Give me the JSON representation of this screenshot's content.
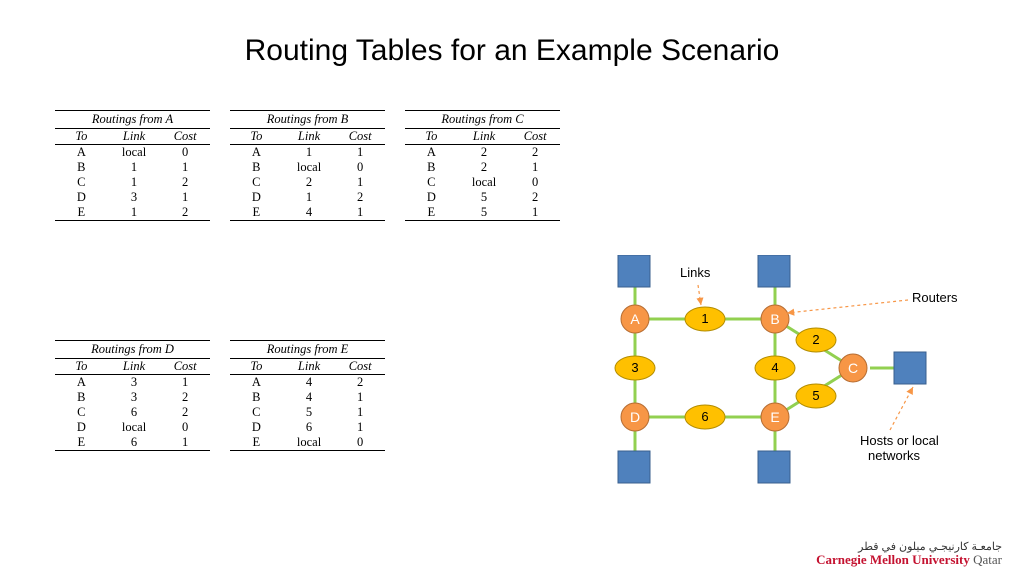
{
  "title": "Routing Tables for an Example Scenario",
  "headers": {
    "to": "To",
    "link": "Link",
    "cost": "Cost"
  },
  "tables": {
    "A": {
      "caption": "Routings from A",
      "rows": [
        {
          "to": "A",
          "link": "local",
          "cost": "0"
        },
        {
          "to": "B",
          "link": "1",
          "cost": "1"
        },
        {
          "to": "C",
          "link": "1",
          "cost": "2"
        },
        {
          "to": "D",
          "link": "3",
          "cost": "1"
        },
        {
          "to": "E",
          "link": "1",
          "cost": "2"
        }
      ]
    },
    "B": {
      "caption": "Routings from B",
      "rows": [
        {
          "to": "A",
          "link": "1",
          "cost": "1"
        },
        {
          "to": "B",
          "link": "local",
          "cost": "0"
        },
        {
          "to": "C",
          "link": "2",
          "cost": "1"
        },
        {
          "to": "D",
          "link": "1",
          "cost": "2"
        },
        {
          "to": "E",
          "link": "4",
          "cost": "1"
        }
      ]
    },
    "C": {
      "caption": "Routings from C",
      "rows": [
        {
          "to": "A",
          "link": "2",
          "cost": "2"
        },
        {
          "to": "B",
          "link": "2",
          "cost": "1"
        },
        {
          "to": "C",
          "link": "local",
          "cost": "0"
        },
        {
          "to": "D",
          "link": "5",
          "cost": "2"
        },
        {
          "to": "E",
          "link": "5",
          "cost": "1"
        }
      ]
    },
    "D": {
      "caption": "Routings from D",
      "rows": [
        {
          "to": "A",
          "link": "3",
          "cost": "1"
        },
        {
          "to": "B",
          "link": "3",
          "cost": "2"
        },
        {
          "to": "C",
          "link": "6",
          "cost": "2"
        },
        {
          "to": "D",
          "link": "local",
          "cost": "0"
        },
        {
          "to": "E",
          "link": "6",
          "cost": "1"
        }
      ]
    },
    "E": {
      "caption": "Routings from E",
      "rows": [
        {
          "to": "A",
          "link": "4",
          "cost": "2"
        },
        {
          "to": "B",
          "link": "4",
          "cost": "1"
        },
        {
          "to": "C",
          "link": "5",
          "cost": "1"
        },
        {
          "to": "D",
          "link": "6",
          "cost": "1"
        },
        {
          "to": "E",
          "link": "local",
          "cost": "0"
        }
      ]
    }
  },
  "diagram": {
    "labels": {
      "links": "Links",
      "routers": "Routers",
      "hosts": "Hosts or local\nnetworks"
    },
    "routers": [
      "A",
      "B",
      "C",
      "D",
      "E"
    ],
    "links": [
      "1",
      "2",
      "3",
      "4",
      "5",
      "6"
    ]
  },
  "footer": {
    "arabic": "جامعـة كارنيجـي ميلون في قطر",
    "english": "Carnegie Mellon University",
    "suffix": " Qatar"
  },
  "colors": {
    "host_fill": "#4f81bd",
    "host_stroke": "#385f8e",
    "router_fill": "#f79646",
    "router_stroke": "#b66d32",
    "link_fill": "#ffc000",
    "link_stroke": "#b28c00",
    "green_line": "#92d050",
    "arrow": "#f79646"
  }
}
